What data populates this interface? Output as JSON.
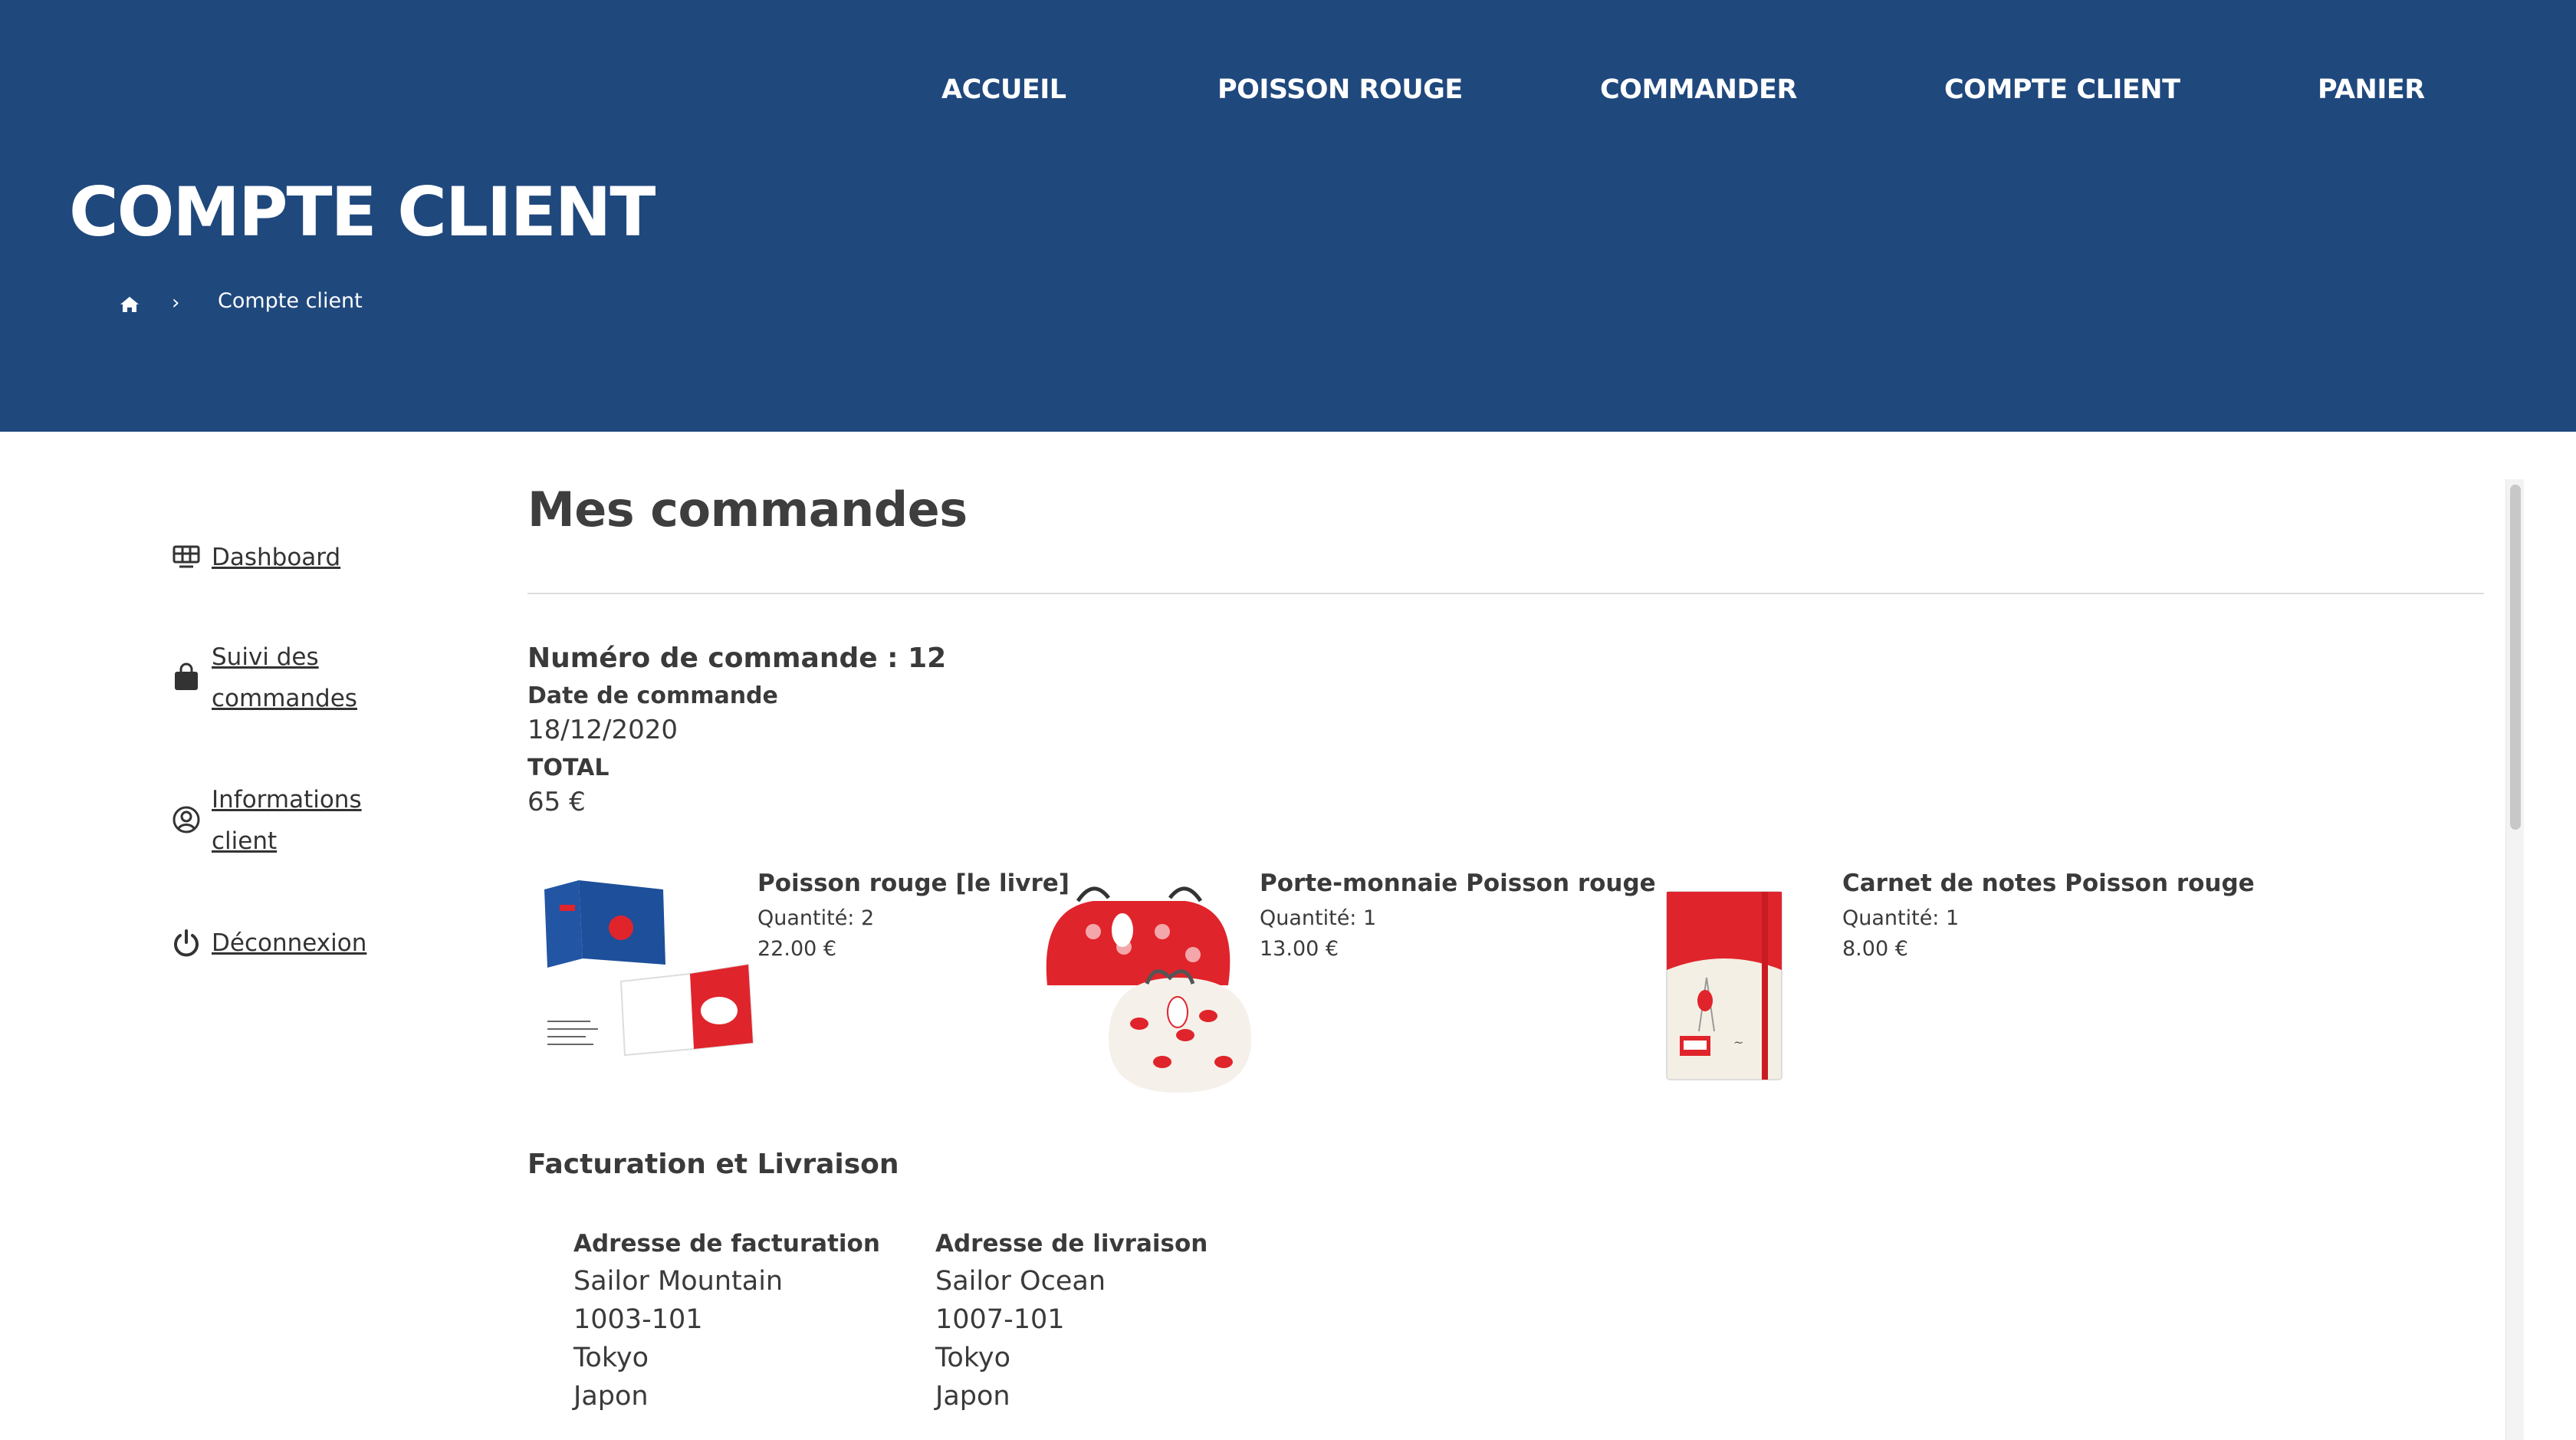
{
  "nav": {
    "items": [
      {
        "label": "ACCUEIL"
      },
      {
        "label": "POISSON ROUGE"
      },
      {
        "label": "COMMANDER"
      },
      {
        "label": "COMPTE CLIENT"
      },
      {
        "label": "PANIER"
      }
    ]
  },
  "header": {
    "title": "COMPTE CLIENT",
    "breadcrumb": {
      "home_icon": "home-icon",
      "separator": "›",
      "current": "Compte client"
    }
  },
  "sidebar": {
    "items": [
      {
        "icon": "dashboard-icon",
        "label": "Dashboard"
      },
      {
        "icon": "shopping-bag-icon",
        "label": "Suivi des commandes"
      },
      {
        "icon": "user-circle-icon",
        "label": "Informations client"
      },
      {
        "icon": "power-icon",
        "label": "Déconnexion"
      }
    ]
  },
  "main": {
    "title": "Mes commandes",
    "order": {
      "number_label": "Numéro de commande : 12",
      "date_label": "Date de commande",
      "date": "18/12/2020",
      "total_label": "TOTAL",
      "total": "65 €"
    },
    "products": [
      {
        "name": "Poisson rouge [le livre]",
        "quantity": "Quantité: 2",
        "price": "22.00 €",
        "image": "book-image"
      },
      {
        "name": "Porte-monnaie Poisson rouge",
        "quantity": "Quantité: 1",
        "price": "13.00 €",
        "image": "coin-purse-image"
      },
      {
        "name": "Carnet de notes Poisson rouge",
        "quantity": "Quantité: 1",
        "price": "8.00 €",
        "image": "notebook-image"
      }
    ],
    "billing": {
      "title": "Facturation et Livraison",
      "billing_address": {
        "title": "Adresse de facturation",
        "lines": [
          "Sailor Mountain",
          "1003-101",
          "Tokyo",
          "Japon"
        ]
      },
      "shipping_address": {
        "title": "Adresse de livraison",
        "lines": [
          "Sailor Ocean",
          "1007-101",
          "Tokyo",
          "Japon"
        ]
      }
    }
  },
  "colors": {
    "header_bg": "#1f487d",
    "header_text": "#ffffff",
    "body_text": "#3a3a3a",
    "accent_red": "#e0242b"
  }
}
